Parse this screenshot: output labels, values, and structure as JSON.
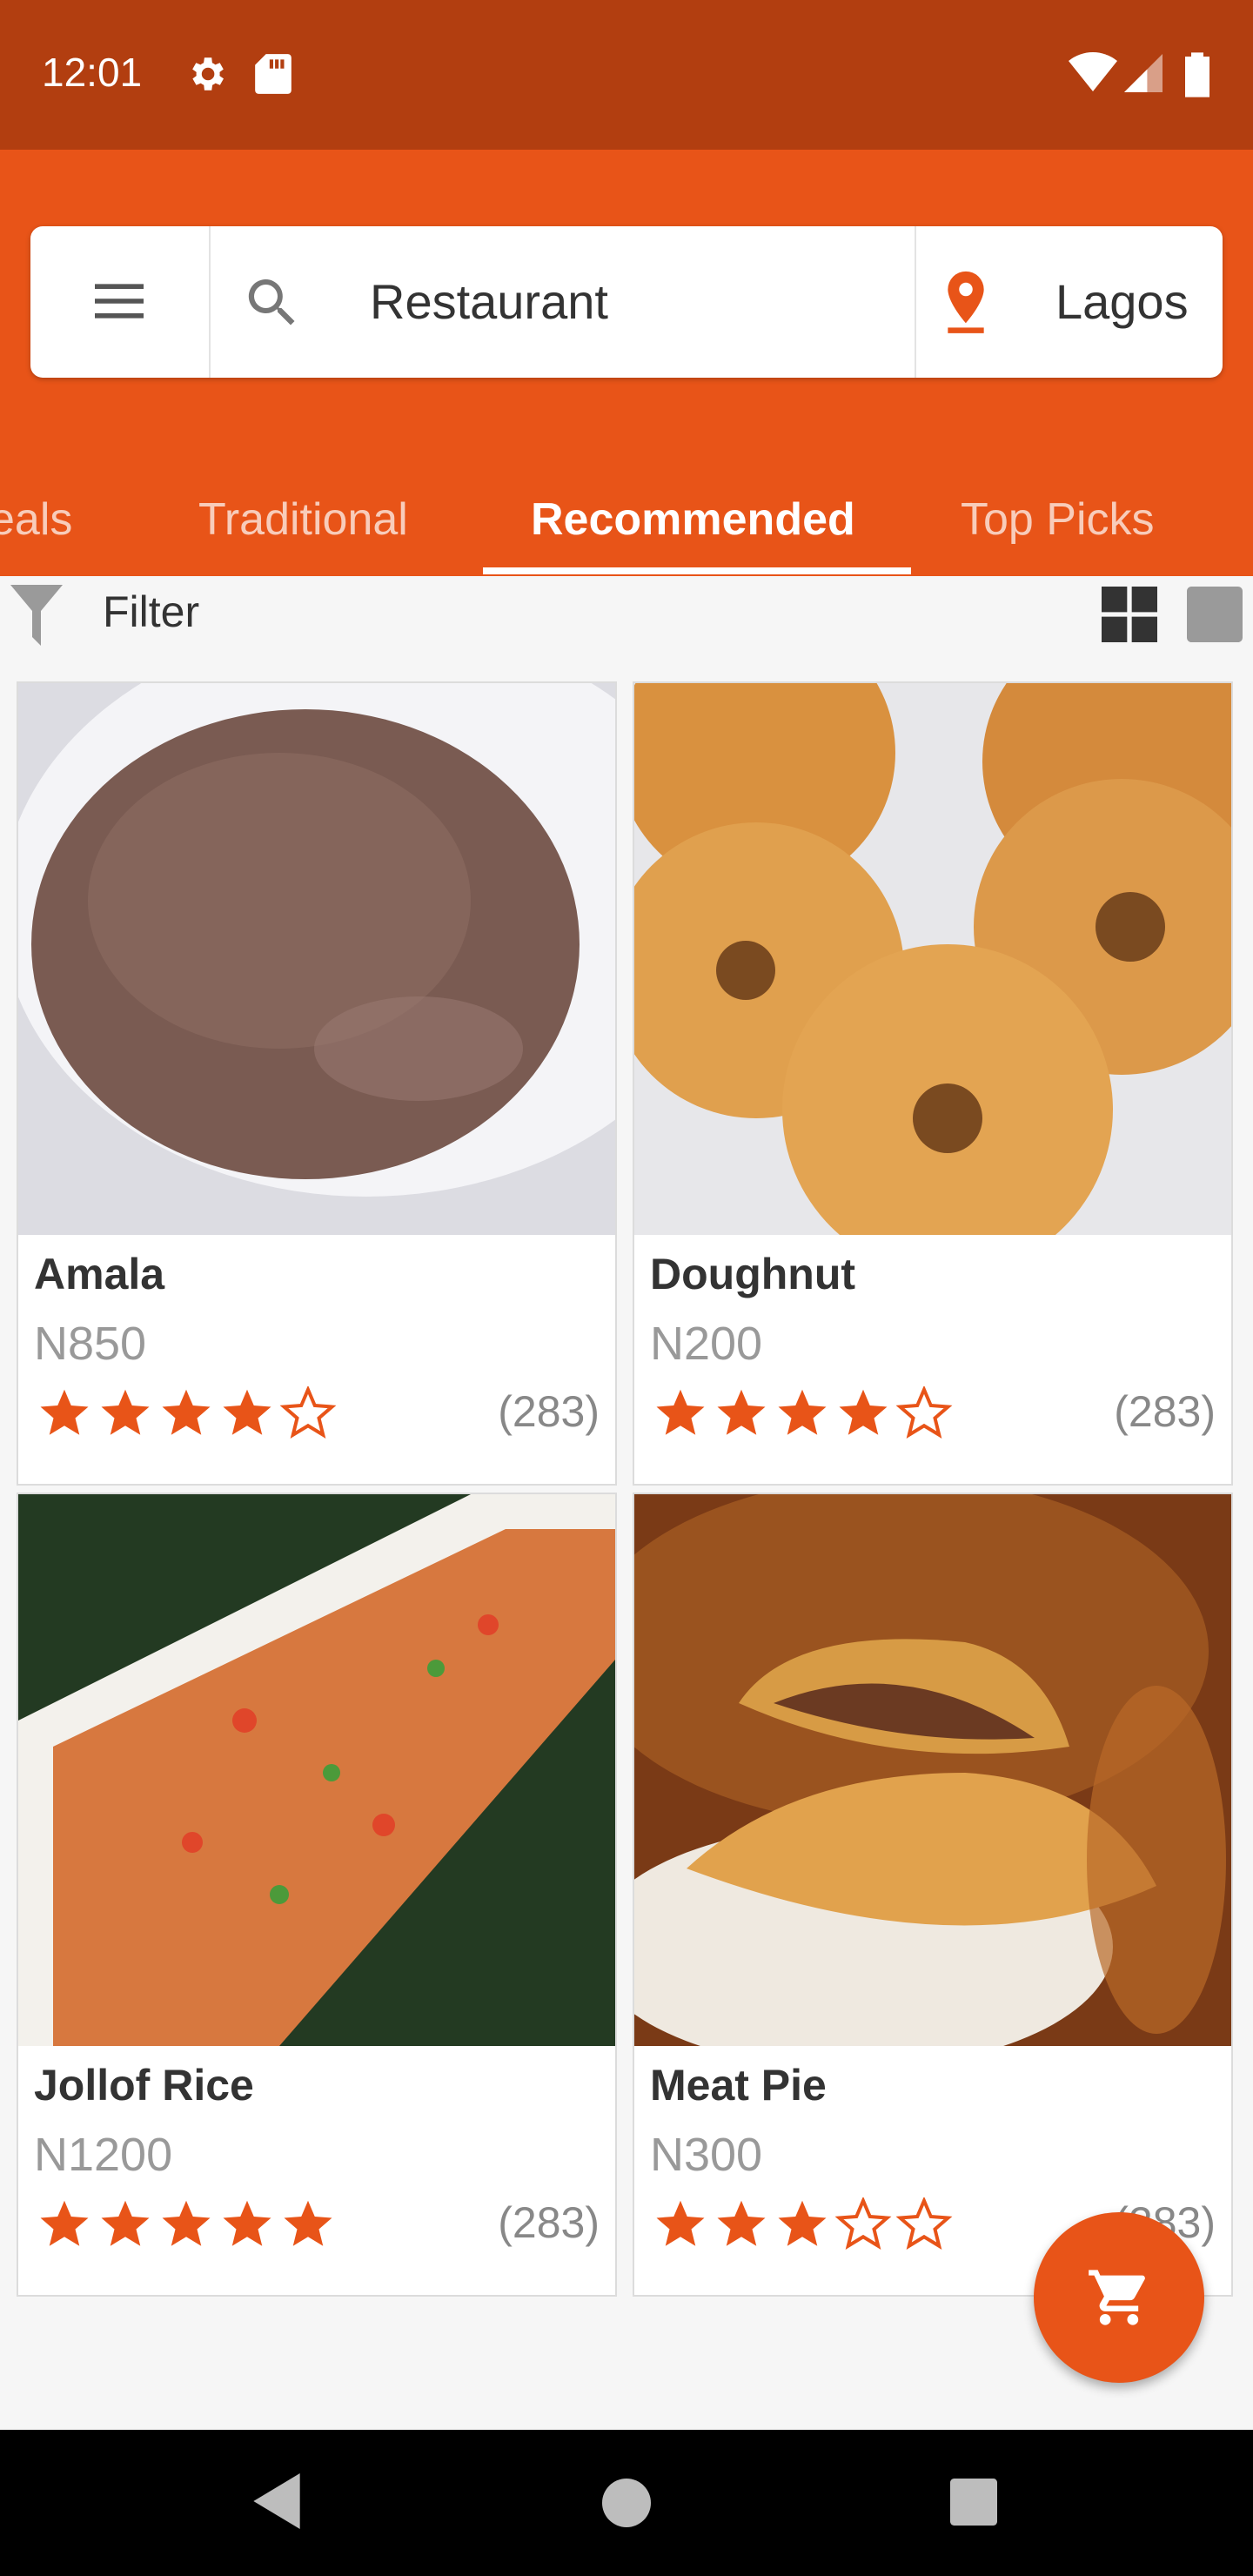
{
  "status": {
    "time": "12:01"
  },
  "search": {
    "query": "Restaurant",
    "location": "Lagos"
  },
  "tabs": [
    {
      "label": "eals"
    },
    {
      "label": "Traditional"
    },
    {
      "label": "Recommended",
      "active": true
    },
    {
      "label": "Top Picks"
    }
  ],
  "filter": {
    "label": "Filter"
  },
  "colors": {
    "brand": "#e85418",
    "status_bar": "#b23e10",
    "star": "#e85418"
  },
  "items": [
    {
      "name": "Amala",
      "price": "N850",
      "rating": 4,
      "count": "(283)"
    },
    {
      "name": "Doughnut",
      "price": "N200",
      "rating": 4,
      "count": "(283)"
    },
    {
      "name": "Jollof Rice",
      "price": "N1200",
      "rating": 5,
      "count": "(283)"
    },
    {
      "name": "Meat Pie",
      "price": "N300",
      "rating": 3,
      "count": "(283)"
    }
  ],
  "icons": [
    "gear-icon",
    "sd-card-icon",
    "wifi-icon",
    "signal-icon",
    "battery-icon",
    "menu-icon",
    "search-icon",
    "location-pin-icon",
    "filter-icon",
    "grid-view-icon",
    "list-view-icon",
    "cart-icon",
    "back-icon",
    "home-icon",
    "recents-icon"
  ]
}
